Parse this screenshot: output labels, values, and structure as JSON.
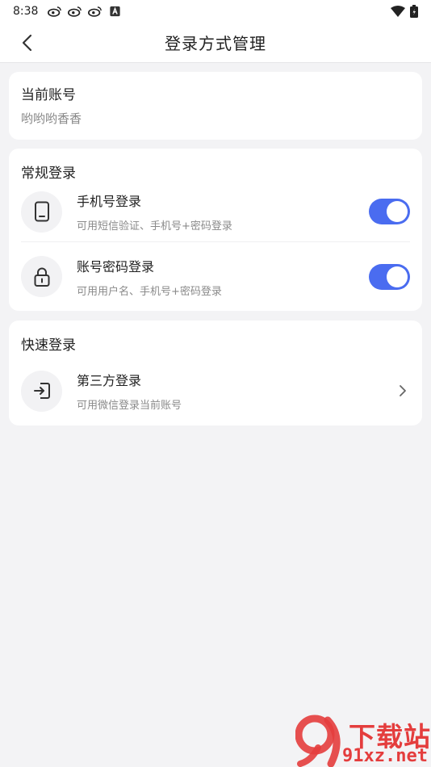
{
  "status_bar": {
    "time": "8:38",
    "left_icons": [
      "weibo-icon",
      "weibo-icon",
      "weibo-icon",
      "font-a-icon"
    ],
    "right_icons": [
      "wifi-icon",
      "battery-icon"
    ]
  },
  "header": {
    "title": "登录方式管理",
    "back_icon": "chevron-left-icon"
  },
  "account": {
    "label": "当前账号",
    "value": "哟哟哟香香"
  },
  "normal_login": {
    "section_title": "常规登录",
    "items": [
      {
        "icon": "phone-icon",
        "title": "手机号登录",
        "subtitle": "可用短信验证、手机号+密码登录",
        "enabled": true
      },
      {
        "icon": "lock-icon",
        "title": "账号密码登录",
        "subtitle": "可用用户名、手机号+密码登录",
        "enabled": true
      }
    ]
  },
  "quick_login": {
    "section_title": "快速登录",
    "items": [
      {
        "icon": "login-arrow-icon",
        "title": "第三方登录",
        "subtitle": "可用微信登录当前账号"
      }
    ]
  },
  "colors": {
    "accent": "#4a6cf0",
    "background": "#f3f3f5",
    "watermark": "#e43d3d"
  },
  "watermark": {
    "text": "下载站",
    "url": "91xz.net"
  }
}
